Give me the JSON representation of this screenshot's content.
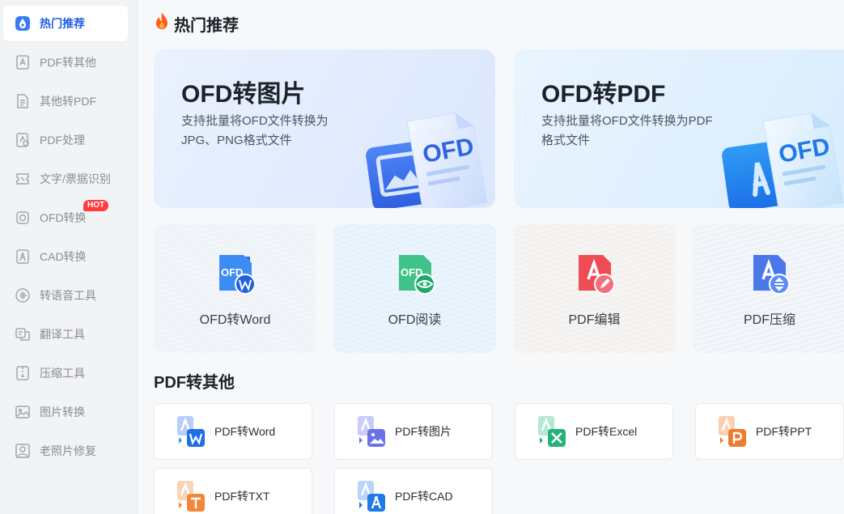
{
  "sidebar": {
    "items": [
      {
        "label": "热门推荐",
        "icon": "drop-badge-icon",
        "active": true
      },
      {
        "label": "PDF转其他",
        "icon": "pdf-export-icon"
      },
      {
        "label": "其他转PDF",
        "icon": "pdf-import-icon"
      },
      {
        "label": "PDF处理",
        "icon": "pdf-process-icon"
      },
      {
        "label": "文字/票据识别",
        "icon": "ticket-scan-icon"
      },
      {
        "label": "OFD转换",
        "icon": "ofd-convert-icon",
        "badge": "HOT"
      },
      {
        "label": "CAD转换",
        "icon": "cad-compass-icon"
      },
      {
        "label": "转语音工具",
        "icon": "voice-wave-icon"
      },
      {
        "label": "翻译工具",
        "icon": "translate-icon"
      },
      {
        "label": "压缩工具",
        "icon": "compress-icon"
      },
      {
        "label": "图片转换",
        "icon": "image-icon"
      },
      {
        "label": "老照片修复",
        "icon": "photo-restore-icon"
      }
    ]
  },
  "hot": {
    "title": "热门推荐",
    "icon": "flame-icon",
    "heroes": [
      {
        "title": "OFD转图片",
        "desc": "支持批量将OFD文件转换为JPG、PNG格式文件",
        "art_text": "OFD"
      },
      {
        "title": "OFD转PDF",
        "desc": "支持批量将OFD文件转换为PDF格式文件",
        "art_text": "OFD"
      }
    ],
    "tiles": [
      {
        "label": "OFD转Word",
        "icon_text": "OFD"
      },
      {
        "label": "OFD阅读",
        "icon_text": "OFD"
      },
      {
        "label": "PDF编辑"
      },
      {
        "label": "PDF压缩"
      }
    ]
  },
  "pdf_other": {
    "title": "PDF转其他",
    "tools": [
      {
        "label": "PDF转Word",
        "color": "#1e6fe8",
        "icon": "pdf-to-word-icon"
      },
      {
        "label": "PDF转图片",
        "color": "#6b72e8",
        "icon": "pdf-to-image-icon"
      },
      {
        "label": "PDF转Excel",
        "color": "#23b37a",
        "icon": "pdf-to-excel-icon"
      },
      {
        "label": "PDF转PPT",
        "color": "#f07b2e",
        "icon": "pdf-to-ppt-icon"
      },
      {
        "label": "PDF转TXT",
        "color": "#f2873a",
        "icon": "pdf-to-txt-icon"
      },
      {
        "label": "PDF转CAD",
        "color": "#1e7ae8",
        "icon": "pdf-to-cad-icon"
      }
    ]
  },
  "colors": {
    "accent": "#1f5fe0",
    "hot_badge": "#ff3b3b",
    "flame": "#ff5a1f"
  }
}
